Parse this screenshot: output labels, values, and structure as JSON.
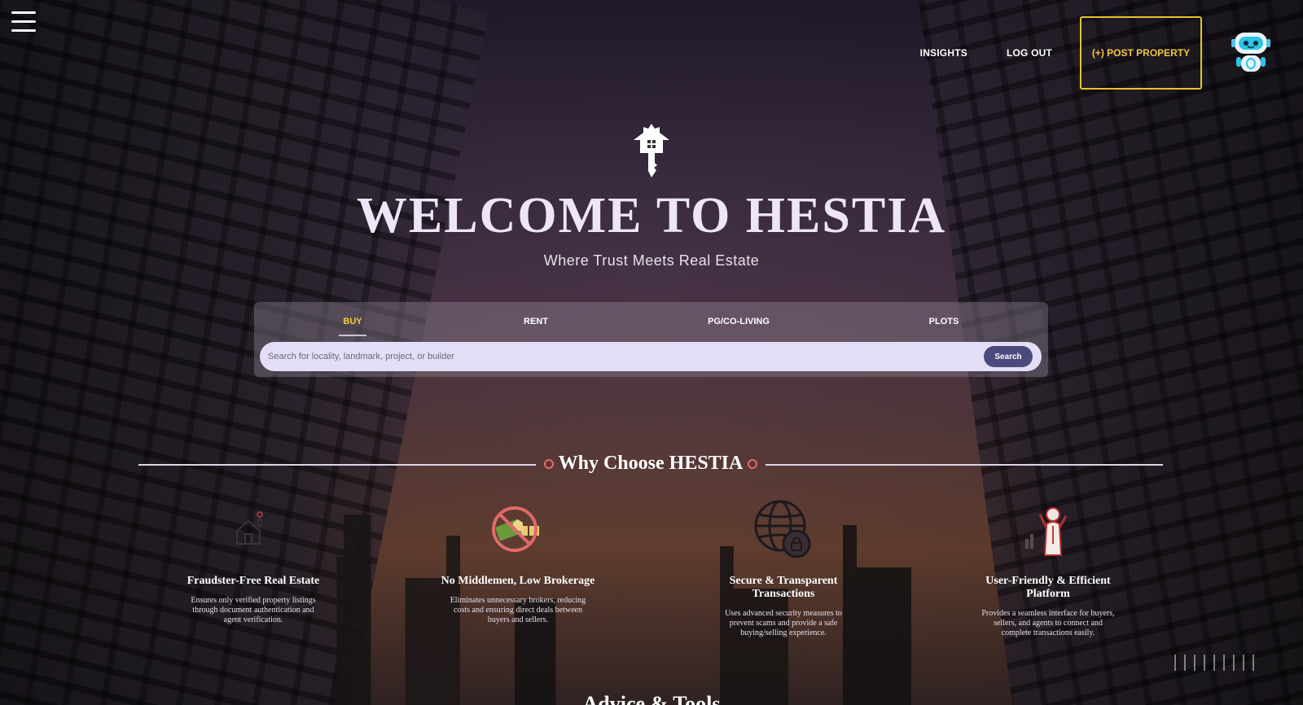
{
  "nav": {
    "insights": "INSIGHTS",
    "logout": "LOG OUT",
    "post_property": "(+) POST PROPERTY"
  },
  "hero": {
    "title": "WELCOME TO HESTIA",
    "subtitle": "Where Trust Meets Real Estate"
  },
  "search": {
    "tabs": [
      {
        "label": "BUY",
        "active": true
      },
      {
        "label": "RENT",
        "active": false
      },
      {
        "label": "PG/CO-LIVING",
        "active": false
      },
      {
        "label": "PLOTS",
        "active": false
      }
    ],
    "placeholder": "Search for locality, landmark, project, or builder",
    "button": "Search"
  },
  "why": {
    "title": "Why Choose HESTIA"
  },
  "features": [
    {
      "title": "Fraudster-Free Real Estate",
      "desc": "Ensures only verified property listings through document authentication and agent verification.",
      "icon": "verified-house-icon"
    },
    {
      "title": "No Middlemen, Low Brokerage",
      "desc": "Eliminates unnecessary brokers, reducing costs and ensuring direct deals between buyers and sellers.",
      "icon": "no-broker-icon"
    },
    {
      "title": "Secure & Transparent Transactions",
      "desc": "Uses advanced security measures to prevent scams and provide a safe buying/selling experience.",
      "icon": "globe-lock-icon"
    },
    {
      "title": "User-Friendly & Efficient Platform",
      "desc": "Provides a seamless interface for buyers, sellers, and agents to connect and complete transactions easily.",
      "icon": "user-chart-icon"
    }
  ],
  "advice": {
    "title": "Advice & Tools"
  },
  "colors": {
    "accent_gold": "#f1c842",
    "search_button": "#4a4a7c",
    "search_bar": "#e3def6",
    "divider_dot": "#e86a6a"
  }
}
